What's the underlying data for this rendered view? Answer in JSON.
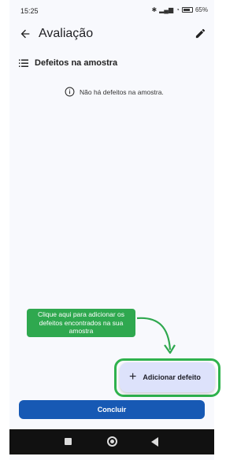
{
  "status_bar": {
    "time": "15:25",
    "battery": "65%"
  },
  "app_bar": {
    "title": "Avaliação",
    "back_icon": "arrow-left-icon",
    "edit_icon": "pencil-icon"
  },
  "section": {
    "title": "Defeitos na amostra",
    "icon": "list-icon"
  },
  "empty_state": {
    "icon": "info-icon",
    "text": "Não há defeitos na amostra."
  },
  "hint": {
    "text": "Clique aqui para adicionar os defeitos encontrados na sua amostra",
    "color": "#2fa84f"
  },
  "fab": {
    "icon": "plus-icon",
    "label": "Adicionar defeito",
    "background": "#dde2fb",
    "highlight_color": "#2fb24d"
  },
  "conclude": {
    "label": "Concluir",
    "color": "#1759b4"
  },
  "nav_bar": {
    "recent_icon": "square-icon",
    "home_icon": "circle-icon",
    "back_icon": "triangle-back-icon"
  }
}
